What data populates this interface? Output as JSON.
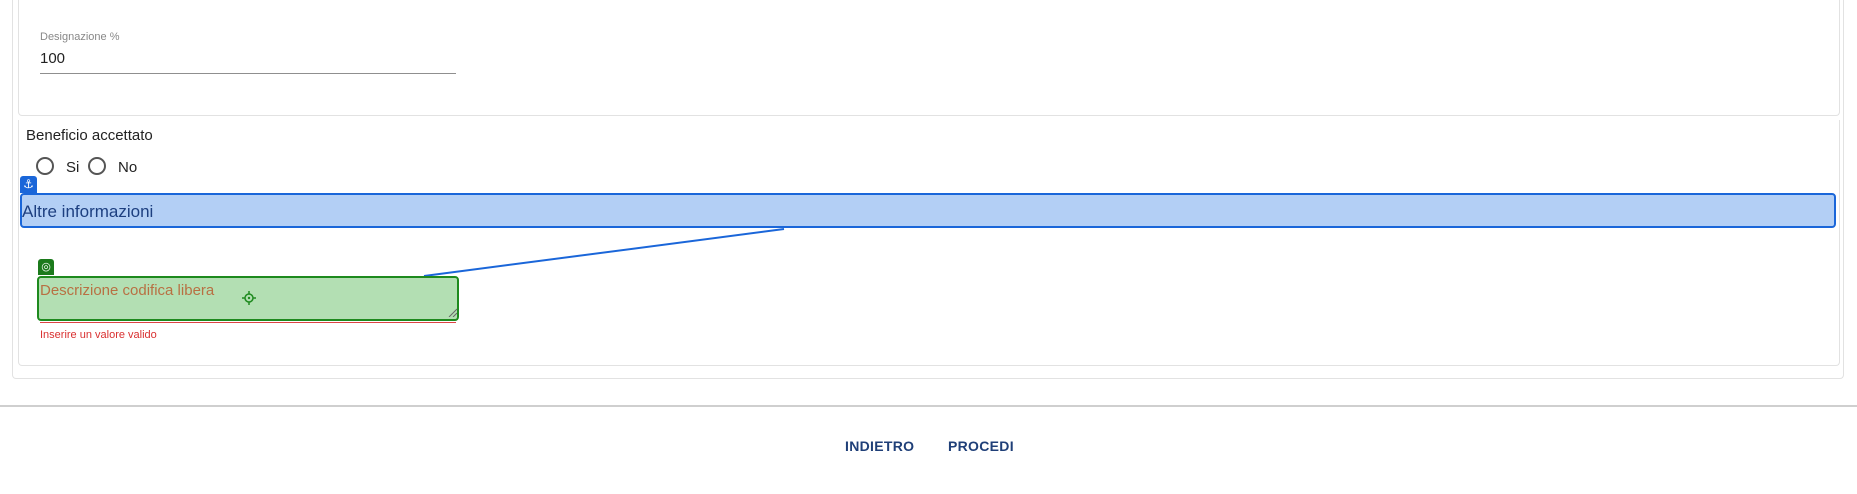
{
  "beneficiary": {
    "designation_label": "Designazione %",
    "designation_value": "100"
  },
  "benefit": {
    "label": "Beneficio accettato",
    "option_yes": "Si",
    "option_no": "No"
  },
  "other_info": {
    "section_title": "Altre informazioni",
    "description_placeholder": "Descrizione codifica libera",
    "error_message": "Inserire un valore valido"
  },
  "footer": {
    "back_label": "INDIETRO",
    "proceed_label": "PROCEDI"
  },
  "icons": {
    "anchor": "anchor-icon",
    "target": "target-icon",
    "crosshair": "crosshair-icon"
  },
  "colors": {
    "anchor_highlight": "#1a66d9",
    "target_highlight": "#1e8a1e",
    "error": "#d93030",
    "footer_button": "#1f3f78"
  }
}
